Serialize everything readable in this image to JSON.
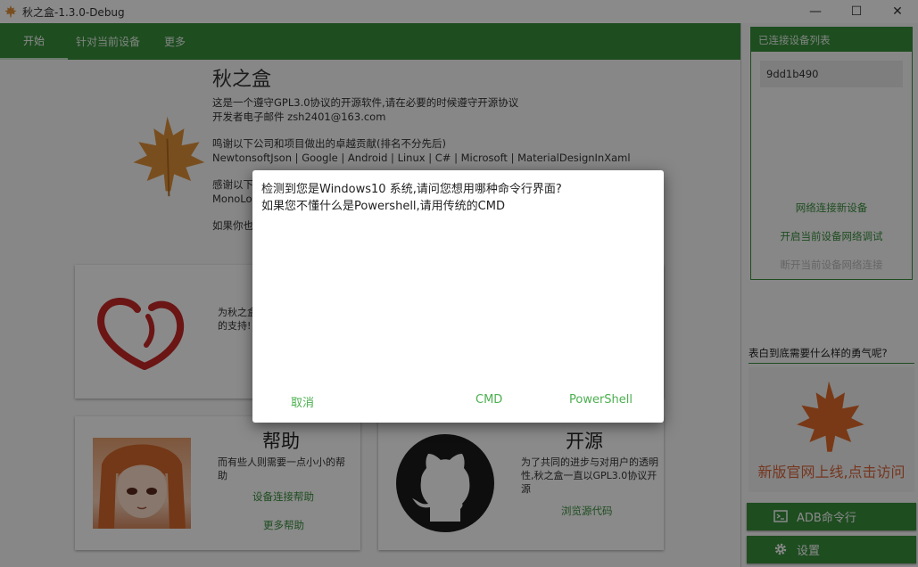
{
  "window": {
    "title": "秋之盒-1.3.0-Debug",
    "controls": {
      "minimize": "—",
      "maximize": "☐",
      "close": "✕"
    }
  },
  "tabs": [
    {
      "label": "开始",
      "active": true
    },
    {
      "label": "针对当前设备",
      "active": false
    },
    {
      "label": "更多",
      "active": false
    }
  ],
  "about": {
    "app_name": "秋之盒",
    "line1": "这是一个遵守GPL3.0协议的开源软件,请在必要的时候遵守开源协议",
    "line2": "开发者电子邮件 zsh2401@163.com",
    "thanks_title": "鸣谢以下公司和项目做出的卓越贡献(排名不分先后)",
    "thanks_list": " NewtonsoftJson  | Google | Android | Linux | C# | Microsoft | MaterialDesignInXaml",
    "thanks2_partial": "感谢以下",
    "thanks2_cont": "MonoLo",
    "if_partial": "如果你也"
  },
  "cards": {
    "support": {
      "desc_line1": "为秋之盒",
      "desc_line2": "的支持!"
    },
    "help": {
      "title": "帮助",
      "desc": "而有些人则需要一点小小的帮助",
      "link1": "设备连接帮助",
      "link2": "更多帮助"
    },
    "source": {
      "title": "开源",
      "desc": "为了共同的进步与对用户的透明性,秋之盒一直以GPL3.0协议开源",
      "link": "浏览源代码"
    }
  },
  "right_panel": {
    "device_list_header": "已连接设备列表",
    "devices": [
      "9dd1b490"
    ],
    "link_network": "网络连接新设备",
    "link_debug": "开启当前设备网络调试",
    "link_faded": "断开当前设备网络连接",
    "brave_text": "表白到底需要什么样的勇气呢?",
    "promo_text": "新版官网上线,点击访问",
    "btn_adb": "ADB命令行",
    "btn_settings": "设置"
  },
  "dialog": {
    "line1": "检测到您是Windows10 系统,请问您想用哪种命令行界面?",
    "line2": "如果您不懂什么是Powershell,请用传统的CMD",
    "btn_cancel": "取消",
    "btn_cmd": "CMD",
    "btn_powershell": "PowerShell"
  },
  "colors": {
    "primary": "#388e3c",
    "accent_text": "#4caf50",
    "promo_text": "#d9643a",
    "leaf": "#e0903a"
  }
}
